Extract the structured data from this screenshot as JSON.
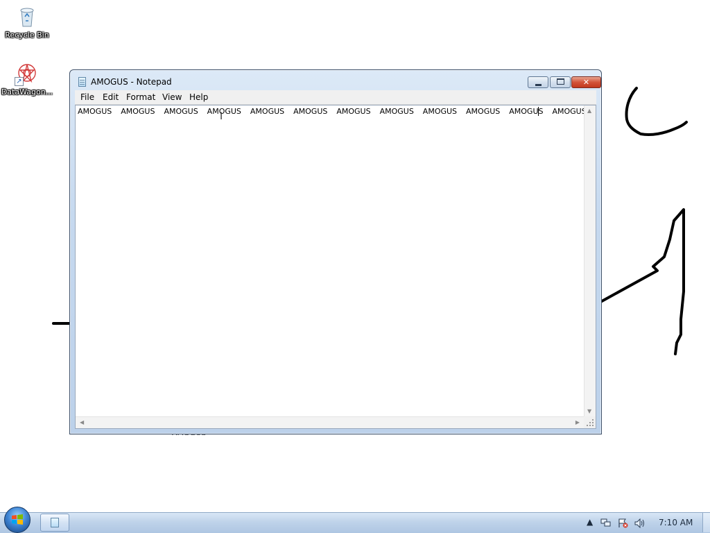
{
  "desktop": {
    "icons": [
      {
        "label": "Recycle Bin",
        "icon": "recycle-bin-icon"
      },
      {
        "label": "DataWagon...",
        "icon": "datawagon-icon"
      }
    ],
    "behind_text": "AMOGUS"
  },
  "notepad": {
    "title": "AMOGUS - Notepad",
    "controls": {
      "minimize": "minimize",
      "maximize": "maximize",
      "close": "✕"
    },
    "menu": [
      "File",
      "Edit",
      "Format",
      "View",
      "Help"
    ],
    "content": "AMOGUS  AMOGUS  AMOGUS  AMOGUS  AMOGUS  AMOGUS  AMOGUS  AMOGUS  AMOGUS  AMOGUS  AMOGUS  AMOGUS"
  },
  "taskbar": {
    "clock": "7:10 AM",
    "tray_icons": [
      "show-hidden-icons-icon",
      "network-icon",
      "action-center-flag-icon",
      "volume-icon"
    ]
  },
  "colors": {
    "titlebar": "#c6d9ef",
    "close_button": "#c2391e",
    "taskbar": "#bfd3ea",
    "scribble": "#000000"
  }
}
